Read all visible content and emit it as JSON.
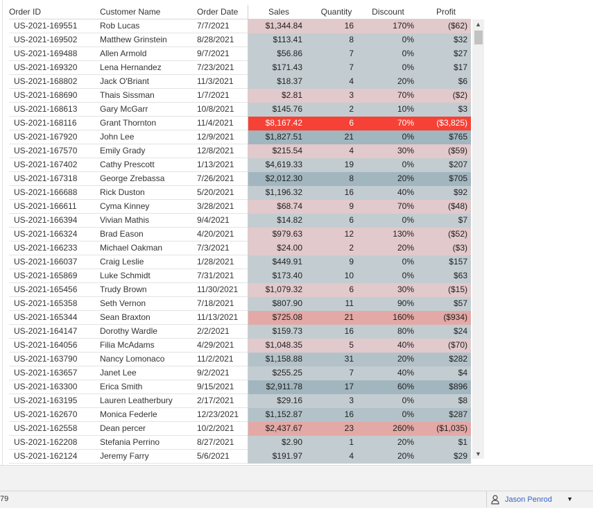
{
  "columns": {
    "order_id": "Order ID",
    "customer_name": "Customer Name",
    "order_date": "Order Date",
    "sales": "Sales",
    "quantity": "Quantity",
    "discount": "Discount",
    "profit": "Profit"
  },
  "colors": {
    "loss_light": "#e2c9cb",
    "loss_medium": "#e3a9a6",
    "loss_strong": "#f64136",
    "profit_light": "#c3cdd1",
    "profit_medium": "#b3c2c8",
    "profit_strong": "#a2b6bf"
  },
  "rows": [
    {
      "id": "US-2021-169551",
      "name": "Rob Lucas",
      "date": "7/7/2021",
      "sales": "$1,344.84",
      "qty": "16",
      "disc": "170%",
      "profit": "($62)",
      "tone": "loss_light"
    },
    {
      "id": "US-2021-169502",
      "name": "Matthew Grinstein",
      "date": "8/28/2021",
      "sales": "$113.41",
      "qty": "8",
      "disc": "0%",
      "profit": "$32",
      "tone": "profit_light"
    },
    {
      "id": "US-2021-169488",
      "name": "Allen Armold",
      "date": "9/7/2021",
      "sales": "$56.86",
      "qty": "7",
      "disc": "0%",
      "profit": "$27",
      "tone": "profit_light"
    },
    {
      "id": "US-2021-169320",
      "name": "Lena Hernandez",
      "date": "7/23/2021",
      "sales": "$171.43",
      "qty": "7",
      "disc": "0%",
      "profit": "$17",
      "tone": "profit_light"
    },
    {
      "id": "US-2021-168802",
      "name": "Jack O'Briant",
      "date": "11/3/2021",
      "sales": "$18.37",
      "qty": "4",
      "disc": "20%",
      "profit": "$6",
      "tone": "profit_light"
    },
    {
      "id": "US-2021-168690",
      "name": "Thais Sissman",
      "date": "1/7/2021",
      "sales": "$2.81",
      "qty": "3",
      "disc": "70%",
      "profit": "($2)",
      "tone": "loss_light"
    },
    {
      "id": "US-2021-168613",
      "name": "Gary McGarr",
      "date": "10/8/2021",
      "sales": "$145.76",
      "qty": "2",
      "disc": "10%",
      "profit": "$3",
      "tone": "profit_light"
    },
    {
      "id": "US-2021-168116",
      "name": "Grant Thornton",
      "date": "11/4/2021",
      "sales": "$8,167.42",
      "qty": "6",
      "disc": "70%",
      "profit": "($3,825)",
      "tone": "loss_strong"
    },
    {
      "id": "US-2021-167920",
      "name": "John Lee",
      "date": "12/9/2021",
      "sales": "$1,827.51",
      "qty": "21",
      "disc": "0%",
      "profit": "$765",
      "tone": "profit_strong"
    },
    {
      "id": "US-2021-167570",
      "name": "Emily Grady",
      "date": "12/8/2021",
      "sales": "$215.54",
      "qty": "4",
      "disc": "30%",
      "profit": "($59)",
      "tone": "loss_light"
    },
    {
      "id": "US-2021-167402",
      "name": "Cathy Prescott",
      "date": "1/13/2021",
      "sales": "$4,619.33",
      "qty": "19",
      "disc": "0%",
      "profit": "$207",
      "tone": "profit_light"
    },
    {
      "id": "US-2021-167318",
      "name": "George Zrebassa",
      "date": "7/26/2021",
      "sales": "$2,012.30",
      "qty": "8",
      "disc": "20%",
      "profit": "$705",
      "tone": "profit_strong"
    },
    {
      "id": "US-2021-166688",
      "name": "Rick Duston",
      "date": "5/20/2021",
      "sales": "$1,196.32",
      "qty": "16",
      "disc": "40%",
      "profit": "$92",
      "tone": "profit_light"
    },
    {
      "id": "US-2021-166611",
      "name": "Cyma Kinney",
      "date": "3/28/2021",
      "sales": "$68.74",
      "qty": "9",
      "disc": "70%",
      "profit": "($48)",
      "tone": "loss_light"
    },
    {
      "id": "US-2021-166394",
      "name": "Vivian Mathis",
      "date": "9/4/2021",
      "sales": "$14.82",
      "qty": "6",
      "disc": "0%",
      "profit": "$7",
      "tone": "profit_light"
    },
    {
      "id": "US-2021-166324",
      "name": "Brad Eason",
      "date": "4/20/2021",
      "sales": "$979.63",
      "qty": "12",
      "disc": "130%",
      "profit": "($52)",
      "tone": "loss_light"
    },
    {
      "id": "US-2021-166233",
      "name": "Michael Oakman",
      "date": "7/3/2021",
      "sales": "$24.00",
      "qty": "2",
      "disc": "20%",
      "profit": "($3)",
      "tone": "loss_light"
    },
    {
      "id": "US-2021-166037",
      "name": "Craig Leslie",
      "date": "1/28/2021",
      "sales": "$449.91",
      "qty": "9",
      "disc": "0%",
      "profit": "$157",
      "tone": "profit_light"
    },
    {
      "id": "US-2021-165869",
      "name": "Luke Schmidt",
      "date": "7/31/2021",
      "sales": "$173.40",
      "qty": "10",
      "disc": "0%",
      "profit": "$63",
      "tone": "profit_light"
    },
    {
      "id": "US-2021-165456",
      "name": "Trudy Brown",
      "date": "11/30/2021",
      "sales": "$1,079.32",
      "qty": "6",
      "disc": "30%",
      "profit": "($15)",
      "tone": "loss_light"
    },
    {
      "id": "US-2021-165358",
      "name": "Seth Vernon",
      "date": "7/18/2021",
      "sales": "$807.90",
      "qty": "11",
      "disc": "90%",
      "profit": "$57",
      "tone": "profit_light"
    },
    {
      "id": "US-2021-165344",
      "name": "Sean Braxton",
      "date": "11/13/2021",
      "sales": "$725.08",
      "qty": "21",
      "disc": "160%",
      "profit": "($934)",
      "tone": "loss_medium"
    },
    {
      "id": "US-2021-164147",
      "name": "Dorothy Wardle",
      "date": "2/2/2021",
      "sales": "$159.73",
      "qty": "16",
      "disc": "80%",
      "profit": "$24",
      "tone": "profit_light"
    },
    {
      "id": "US-2021-164056",
      "name": "Filia McAdams",
      "date": "4/29/2021",
      "sales": "$1,048.35",
      "qty": "5",
      "disc": "40%",
      "profit": "($70)",
      "tone": "loss_light"
    },
    {
      "id": "US-2021-163790",
      "name": "Nancy Lomonaco",
      "date": "11/2/2021",
      "sales": "$1,158.88",
      "qty": "31",
      "disc": "20%",
      "profit": "$282",
      "tone": "profit_medium"
    },
    {
      "id": "US-2021-163657",
      "name": "Janet Lee",
      "date": "9/2/2021",
      "sales": "$255.25",
      "qty": "7",
      "disc": "40%",
      "profit": "$4",
      "tone": "profit_light"
    },
    {
      "id": "US-2021-163300",
      "name": "Erica Smith",
      "date": "9/15/2021",
      "sales": "$2,911.78",
      "qty": "17",
      "disc": "60%",
      "profit": "$896",
      "tone": "profit_strong"
    },
    {
      "id": "US-2021-163195",
      "name": "Lauren Leatherbury",
      "date": "2/17/2021",
      "sales": "$29.16",
      "qty": "3",
      "disc": "0%",
      "profit": "$8",
      "tone": "profit_light"
    },
    {
      "id": "US-2021-162670",
      "name": "Monica Federle",
      "date": "12/23/2021",
      "sales": "$1,152.87",
      "qty": "16",
      "disc": "0%",
      "profit": "$287",
      "tone": "profit_medium"
    },
    {
      "id": "US-2021-162558",
      "name": "Dean percer",
      "date": "10/2/2021",
      "sales": "$2,437.67",
      "qty": "23",
      "disc": "260%",
      "profit": "($1,035)",
      "tone": "loss_medium"
    },
    {
      "id": "US-2021-162208",
      "name": "Stefania Perrino",
      "date": "8/27/2021",
      "sales": "$2.90",
      "qty": "1",
      "disc": "20%",
      "profit": "$1",
      "tone": "profit_light"
    },
    {
      "id": "US-2021-162124",
      "name": "Jeremy Farry",
      "date": "5/6/2021",
      "sales": "$191.97",
      "qty": "4",
      "disc": "20%",
      "profit": "$29",
      "tone": "profit_light"
    }
  ],
  "statusbar": {
    "left_text": "79",
    "user_name": "Jason Penrod",
    "user_icon": "user-icon",
    "user_menu_icon": "caret-down-icon"
  },
  "scrollbar": {
    "up_icon": "chevron-up-icon",
    "down_icon": "chevron-down-icon"
  }
}
